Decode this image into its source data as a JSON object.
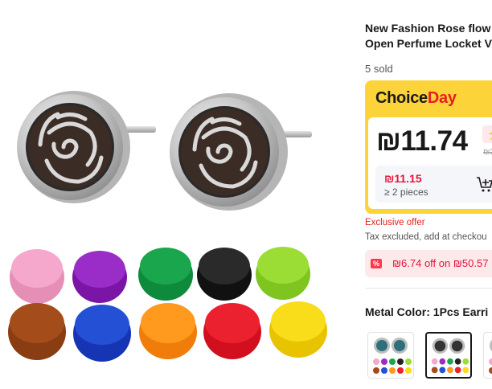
{
  "product": {
    "title_line1": "New Fashion Rose flow",
    "title_line2": "Open Perfume Locket V",
    "sold": "5 sold"
  },
  "choice": {
    "logo_part1": "Choice",
    "logo_part2": "Day",
    "price": "₪11.74",
    "flash_icon": "lightning-icon",
    "original_price": "₪2",
    "tier_price": "₪11.15",
    "tier_qty": "≥ 2 pieces"
  },
  "offer": {
    "exclusive": "Exclusive offer",
    "tax": "Tax excluded, add at checkou",
    "coupon_icon": "%",
    "coupon": "₪6.74 off on ₪50.57"
  },
  "variant": {
    "label": "Metal Color: 1Pcs Earri"
  },
  "colors": {
    "brand_yellow": "#fdd33a",
    "accent_red": "#e61e1e",
    "price_red": "#e6143c"
  }
}
